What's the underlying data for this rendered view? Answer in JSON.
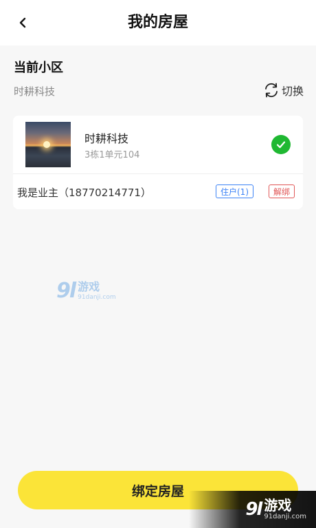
{
  "header": {
    "title": "我的房屋",
    "back_icon": "chevron-left-icon"
  },
  "current_community": {
    "section_title": "当前小区",
    "name": "时耕科技",
    "switch_label": "切换",
    "switch_icon": "refresh-icon"
  },
  "house": {
    "name": "时耕科技",
    "unit": "3栋1单元104",
    "selected": true,
    "check_color": "#1fb832",
    "owner_text": "我是业主（18770214771）",
    "resident_tag": "住户(1)",
    "unbind_tag": "解绑"
  },
  "watermarks": {
    "center_logo": "9l",
    "center_name": "游戏",
    "center_domain": "91danji.com",
    "corner_logo": "9l",
    "corner_name": "游戏",
    "corner_domain": "91danji.com"
  },
  "footer": {
    "bind_button_label": "绑定房屋",
    "bind_button_color": "#fbe438"
  }
}
